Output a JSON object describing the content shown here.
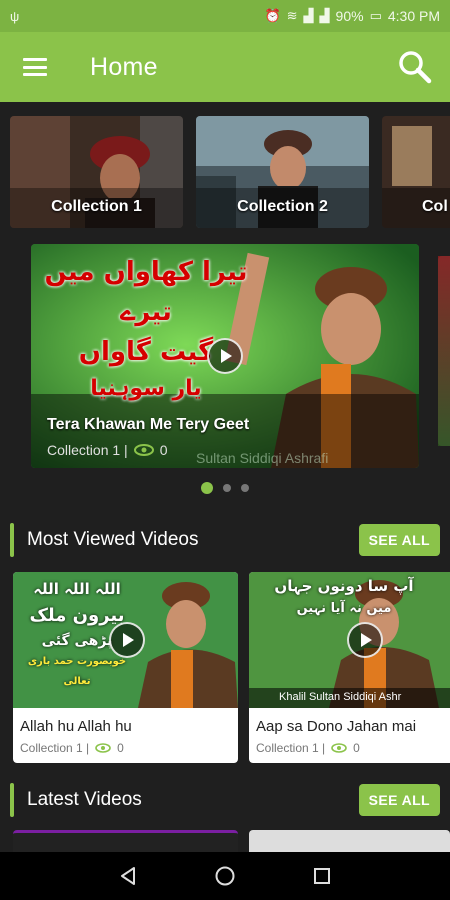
{
  "status_bar": {
    "usb_icon": "usb-icon",
    "battery_percent": "90%",
    "time": "4:30 PM"
  },
  "app_bar": {
    "title": "Home"
  },
  "collections": [
    {
      "label": "Collection 1"
    },
    {
      "label": "Collection 2"
    },
    {
      "label": "Col"
    }
  ],
  "featured": {
    "title": "Tera Khawan Me Tery Geet",
    "collection": "Collection 1 |",
    "views": "0",
    "overlay_text": [
      "تیرا کھاواں میں تیرے",
      "گیت گاواں",
      "یار سوہنیا"
    ],
    "watermark": "Sultan Siddiqi Ashrafi"
  },
  "carousel_dots": 3,
  "most_viewed": {
    "heading": "Most Viewed Videos",
    "see_all": "SEE ALL",
    "videos": [
      {
        "title": "Allah hu Allah hu",
        "collection": "Collection 1 |",
        "views": "0",
        "overlay_text": [
          "اللہ اللہ اللہ",
          "بیرون ملک",
          "پڑھی گئی",
          "خوبصورت حمد باری تعالی"
        ]
      },
      {
        "title": "Aap sa Dono Jahan mai",
        "collection": "Collection 1 |",
        "views": "0",
        "overlay_text": [
          "آپ سا دونوں جہاں",
          "میں نہ آیا نہیں"
        ],
        "watermark": "Khalil Sultan Siddiqi Ashr"
      }
    ]
  },
  "latest": {
    "heading": "Latest Videos",
    "see_all": "SEE ALL"
  },
  "colors": {
    "accent": "#8bc34a",
    "status": "#7cb342",
    "background": "#1f1f1f"
  }
}
